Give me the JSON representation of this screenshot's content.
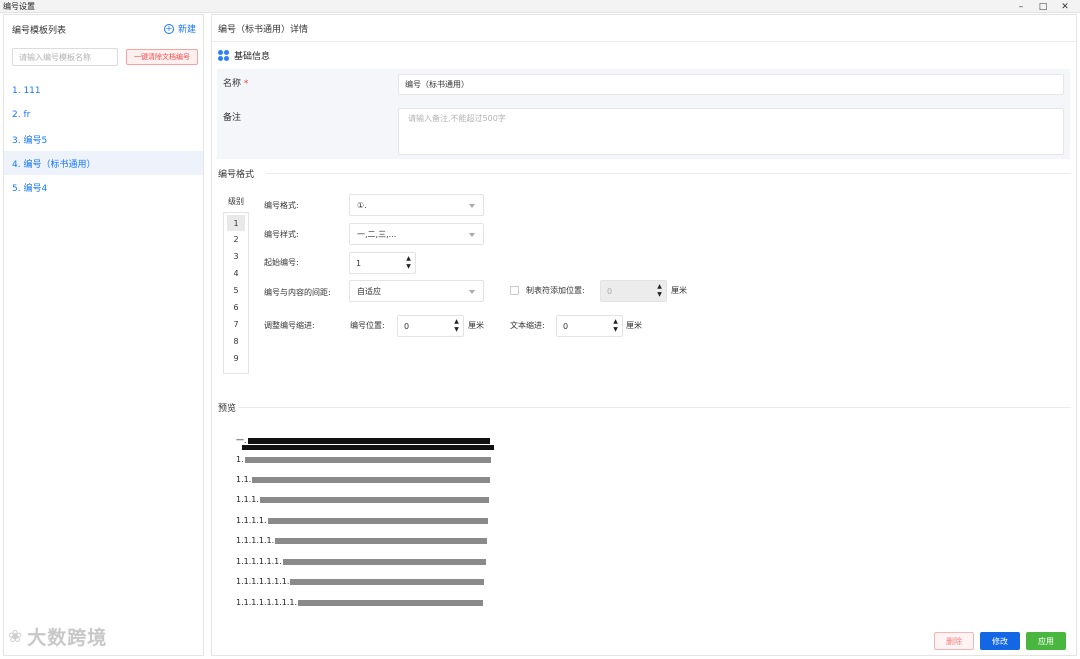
{
  "window": {
    "title": "编号设置",
    "controls": [
      "minimize-icon",
      "maximize-icon",
      "close-icon"
    ]
  },
  "left": {
    "heading": "编号模板列表",
    "new_label": "新建",
    "search_placeholder": "请输入编号模板名称",
    "clear_label": "一键清除文档编号",
    "items": [
      {
        "label": "1. 111"
      },
      {
        "label": "2. fr"
      },
      {
        "label": "3. 编号5"
      },
      {
        "label": "4. 编号（标书通用）",
        "active": true
      },
      {
        "label": "5. 编号4"
      }
    ]
  },
  "detail": {
    "title": "编号（标书通用）详情",
    "basic_section": "基础信息",
    "name_label": "名称",
    "name_required": "*",
    "name_value": "编号（标书通用）",
    "remark_label": "备注",
    "remark_placeholder": "请输入备注,不能超过500字"
  },
  "format": {
    "section_title": "编号格式",
    "level_label": "级别",
    "levels": [
      "1",
      "2",
      "3",
      "4",
      "5",
      "6",
      "7",
      "8",
      "9"
    ],
    "active_level": "1",
    "number_format_label": "编号格式:",
    "number_format_value": "①.",
    "number_style_label": "编号样式:",
    "number_style_value": "一,二,三,...",
    "start_label": "起始编号:",
    "start_value": "1",
    "spacing_label": "编号与内容的间距:",
    "spacing_value": "自适应",
    "tab_label": "制表符添加位置:",
    "tab_value": "0",
    "tab_unit": "厘米",
    "indent_label": "调整编号缩进:",
    "position_label": "编号位置:",
    "position_value": "0",
    "position_unit": "厘米",
    "text_indent_label": "文本缩进:",
    "text_indent_value": "0",
    "text_indent_unit": "厘米"
  },
  "preview": {
    "section_title": "预览",
    "lines": [
      "一.",
      "1.",
      "1.1.",
      "1.1.1.",
      "1.1.1.1.",
      "1.1.1.1.1.",
      "1.1.1.1.1.1.",
      "1.1.1.1.1.1.1.",
      "1.1.1.1.1.1.1.1."
    ]
  },
  "actions": {
    "delete_label": "删除",
    "edit_label": "修改",
    "apply_label": "应用"
  },
  "watermark": {
    "text": "大数跨境"
  },
  "colors": {
    "accent": "#1677ff",
    "danger": "#ec4d4d",
    "edit": "#1467e4",
    "apply": "#49b73f"
  }
}
